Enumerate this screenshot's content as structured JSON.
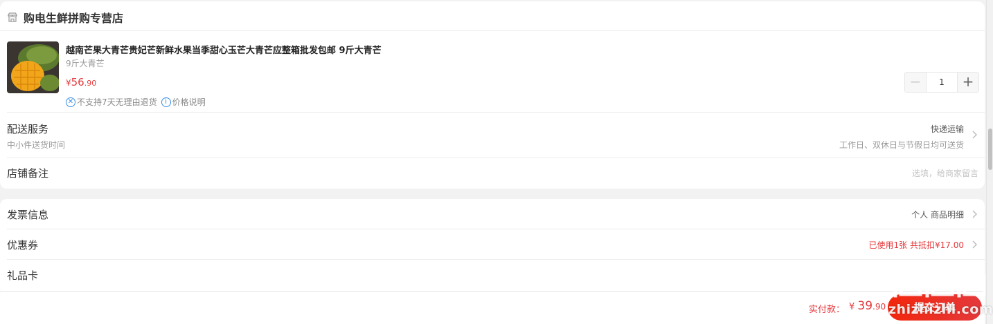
{
  "shop": {
    "name": "购电生鲜拼购专营店",
    "icon": "store-icon"
  },
  "product": {
    "title": "越南芒果大青芒贵妃芒新鲜水果当季甜心玉芒大青芒应整箱批发包邮 9斤大青芒",
    "spec": "9斤大青芒",
    "price_currency": "¥",
    "price_int": "56",
    "price_dec": ".90",
    "quantity": "1",
    "tags": [
      {
        "icon": "no-return-icon",
        "label": "不支持7天无理由退货"
      },
      {
        "icon": "info-icon",
        "label": "价格说明"
      }
    ]
  },
  "delivery": {
    "label": "配送服务",
    "sub": "中小件送货时间",
    "method": "快递运输",
    "time": "工作日、双休日与节假日均可送货"
  },
  "note": {
    "label": "店铺备注",
    "placeholder": "选填，给商家留言"
  },
  "invoice": {
    "label": "发票信息",
    "value": "个人 商品明细"
  },
  "coupon": {
    "label": "优惠券",
    "value": "已使用1张 共抵扣¥17.00"
  },
  "giftcard": {
    "label": "礼品卡"
  },
  "footer": {
    "pay_label": "实付款：",
    "pay_currency": "¥ ",
    "pay_int": "39",
    "pay_dec": ".90",
    "submit_label": "提交订单"
  },
  "watermark": {
    "text": "zhizhizhi.com",
    "logo": "zhi-logo"
  },
  "colors": {
    "accent": "#e4393c",
    "link_blue": "#3a8ee6",
    "background": "#f2f2f2"
  }
}
